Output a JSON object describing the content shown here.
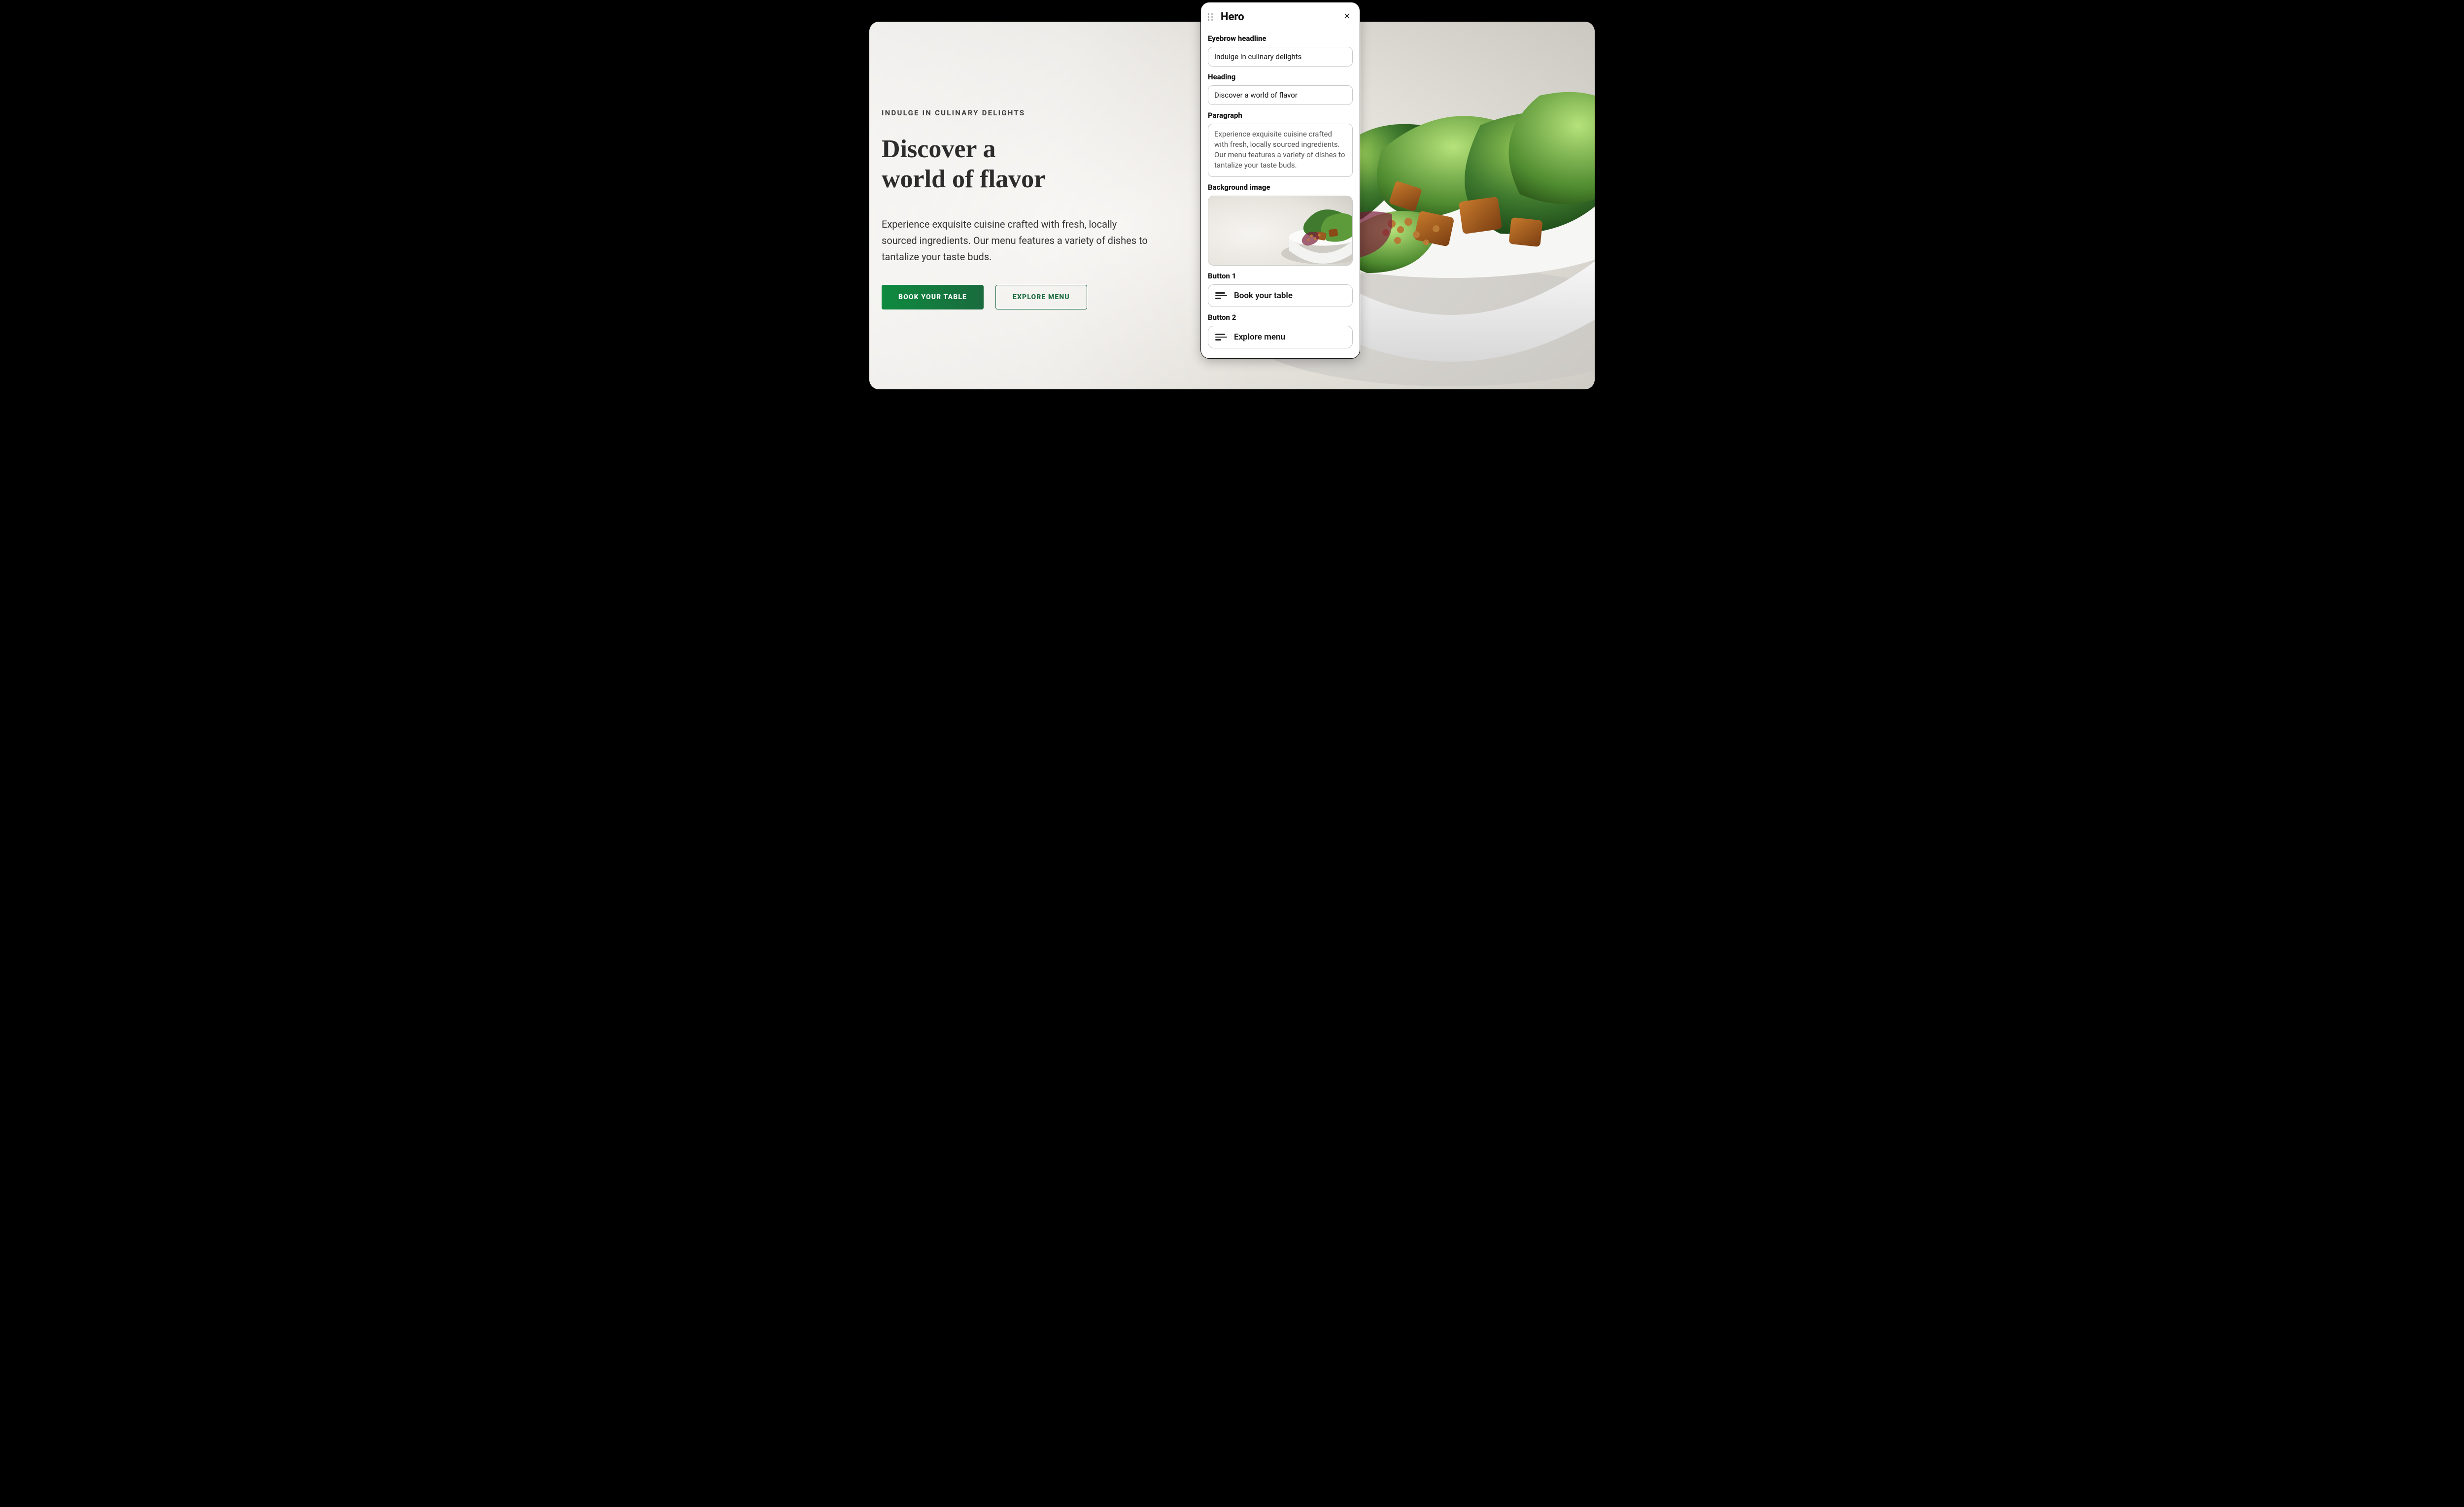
{
  "hero": {
    "eyebrow": "INDULGE IN CULINARY DELIGHTS",
    "heading_line1": "Discover a",
    "heading_line2": "world of flavor",
    "paragraph": "Experience exquisite cuisine crafted with fresh, locally sourced ingredients. Our menu features a variety of dishes to tantalize your taste buds.",
    "button_primary": "BOOK YOUR TABLE",
    "button_outline": "EXPLORE MENU"
  },
  "panel": {
    "title": "Hero",
    "fields": {
      "eyebrow_label": "Eyebrow headline",
      "eyebrow_value": "Indulge in culinary delights",
      "heading_label": "Heading",
      "heading_value": "Discover a world of flavor",
      "paragraph_label": "Paragraph",
      "paragraph_value": "Experience exquisite cuisine crafted with fresh, locally sourced ingredients. Our menu features a variety of dishes to tantalize your taste buds.",
      "bgimage_label": "Background image",
      "button1_label": "Button 1",
      "button1_value": "Book your table",
      "button2_label": "Button 2",
      "button2_value": "Explore menu"
    }
  }
}
